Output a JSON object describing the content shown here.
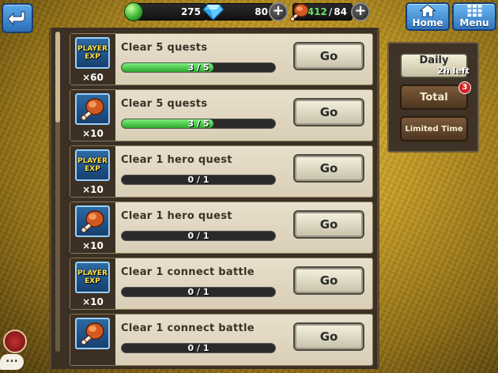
{
  "header": {
    "orbs": "275",
    "gems": "80",
    "stamina_current": "412",
    "stamina_separator": "/",
    "stamina_max": "84",
    "home_label": "Home",
    "menu_label": "Menu",
    "plus_symbol": "+"
  },
  "quests": [
    {
      "title": "Clear 5 quests",
      "reward_type": "player-exp",
      "reward_count": "×60",
      "progress_text": "3 / 5",
      "progress": 0.6,
      "go_label": "Go"
    },
    {
      "title": "Clear 5 quests",
      "reward_type": "stamina-meat",
      "reward_count": "×10",
      "progress_text": "3 / 5",
      "progress": 0.6,
      "go_label": "Go"
    },
    {
      "title": "Clear 1 hero quest",
      "reward_type": "player-exp",
      "reward_count": "×10",
      "progress_text": "0 / 1",
      "progress": 0,
      "go_label": "Go"
    },
    {
      "title": "Clear 1 hero quest",
      "reward_type": "stamina-meat",
      "reward_count": "×10",
      "progress_text": "0 / 1",
      "progress": 0,
      "go_label": "Go"
    },
    {
      "title": "Clear 1 connect battle",
      "reward_type": "player-exp",
      "reward_count": "×10",
      "progress_text": "0 / 1",
      "progress": 0,
      "go_label": "Go"
    },
    {
      "title": "Clear 1 connect battle",
      "reward_type": "stamina-meat",
      "reward_count": "",
      "progress_text": "0 / 1",
      "progress": 0,
      "go_label": "Go"
    }
  ],
  "reward_labels": {
    "exp_line1": "PLAYER",
    "exp_line2": "EXP"
  },
  "filters": {
    "daily_label": "Daily",
    "daily_sub": "2h left",
    "total_label": "Total",
    "total_badge": "3",
    "limited_label": "Limited Time"
  },
  "chat": {
    "bubble_text": "..."
  },
  "colors": {
    "progress_fill": "#2ea82e",
    "top_button": "#2f74c0",
    "badge": "#d42222"
  },
  "icons": {
    "back": "back-arrow-icon",
    "orb": "orb-icon",
    "gem": "gem-icon",
    "stamina": "meat-icon",
    "home": "home-icon",
    "menu": "menu-grid-icon",
    "chat": "chat-icon"
  }
}
